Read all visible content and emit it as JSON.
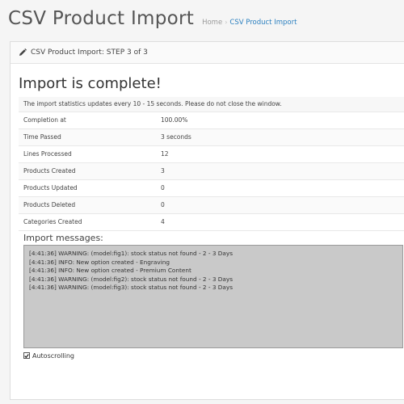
{
  "header": {
    "title": "CSV Product Import",
    "breadcrumb": {
      "home": "Home",
      "separator": "›",
      "current": "CSV Product Import"
    }
  },
  "panel": {
    "heading_icon": "pencil-icon",
    "heading": "CSV Product Import: STEP 3 of 3",
    "complete_title": "Import is complete!",
    "notice": "The import statistics updates every 10 - 15 seconds. Please do not close the window.",
    "stats": [
      {
        "label": "Completion at",
        "value": "100.00%"
      },
      {
        "label": "Time Passed",
        "value": "3 seconds"
      },
      {
        "label": "Lines Processed",
        "value": "12"
      },
      {
        "label": "Products Created",
        "value": "3"
      },
      {
        "label": "Products Updated",
        "value": "0"
      },
      {
        "label": "Products Deleted",
        "value": "0"
      },
      {
        "label": "Categories Created",
        "value": "4"
      }
    ],
    "messages_title": "Import messages:",
    "messages": [
      "[4:41:36] WARNING: (model:fig1): stock status not found - 2 - 3 Days",
      "[4:41:36] INFO: New option created - Engraving",
      "[4:41:36] INFO: New option created - Premium Content",
      "[4:41:36] WARNING: (model:fig2): stock status not found - 2 - 3 Days",
      "[4:41:36] WARNING: (model:fig3): stock status not found - 2 - 3 Days"
    ],
    "autoscroll_label": "Autoscrolling",
    "autoscroll_checked": true
  }
}
